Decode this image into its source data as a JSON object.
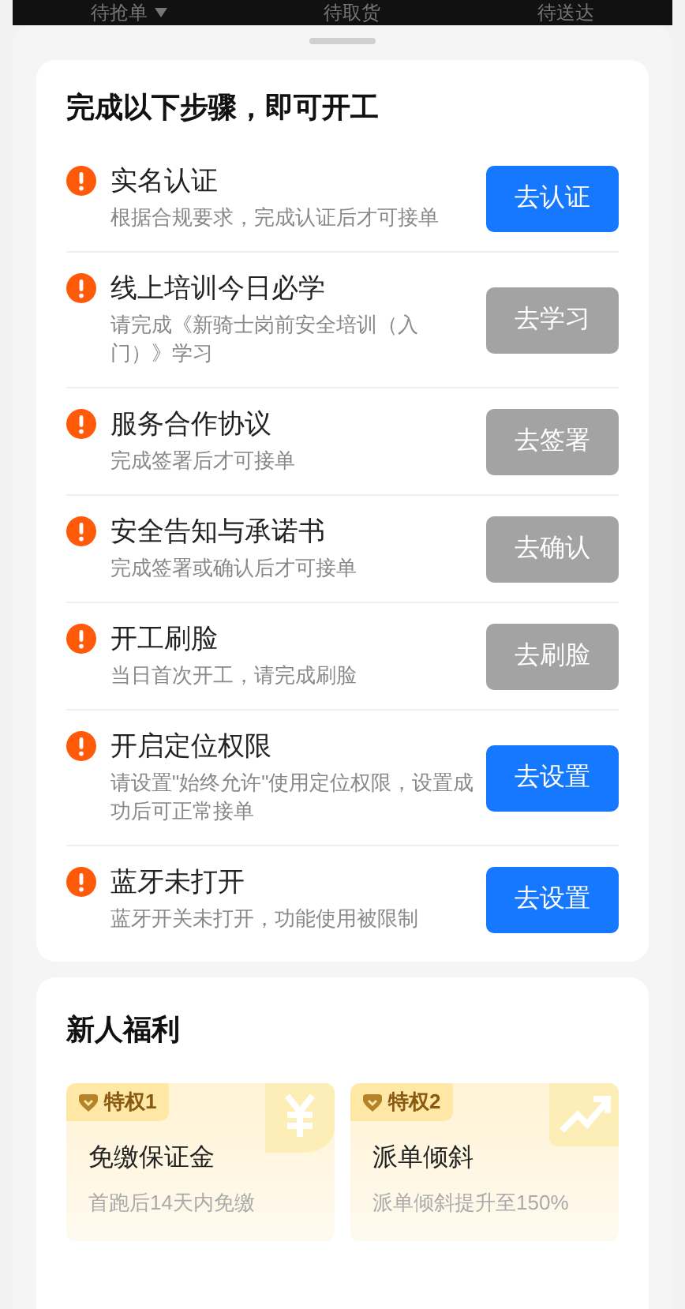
{
  "top_tabs": [
    {
      "label": "待抢单",
      "dropdown": true
    },
    {
      "label": "待取货",
      "dropdown": false
    },
    {
      "label": "待送达",
      "dropdown": false
    }
  ],
  "steps_card": {
    "title": "完成以下步骤，即可开工",
    "steps": [
      {
        "title": "实名认证",
        "description": "根据合规要求，完成认证后才可接单",
        "action": "去认证",
        "enabled": true
      },
      {
        "title": "线上培训今日必学",
        "description": "请完成《新骑士岗前安全培训（入门）》学习",
        "action": "去学习",
        "enabled": false
      },
      {
        "title": "服务合作协议",
        "description": "完成签署后才可接单",
        "action": "去签署",
        "enabled": false
      },
      {
        "title": "安全告知与承诺书",
        "description": "完成签署或确认后才可接单",
        "action": "去确认",
        "enabled": false
      },
      {
        "title": "开工刷脸",
        "description": "当日首次开工，请完成刷脸",
        "action": "去刷脸",
        "enabled": false
      },
      {
        "title": "开启定位权限",
        "description": "请设置\"始终允许\"使用定位权限，设置成功后可正常接单",
        "action": "去设置",
        "enabled": true
      },
      {
        "title": "蓝牙未打开",
        "description": "蓝牙开关未打开，功能使用被限制",
        "action": "去设置",
        "enabled": true
      }
    ]
  },
  "benefits_card": {
    "title": "新人福利",
    "benefits": [
      {
        "tag": "特权1",
        "title": "免缴保证金",
        "description": "首跑后14天内免缴",
        "kind": "money"
      },
      {
        "tag": "特权2",
        "title": "派单倾斜",
        "description": "派单倾斜提升至150%",
        "kind": "trend"
      }
    ]
  }
}
